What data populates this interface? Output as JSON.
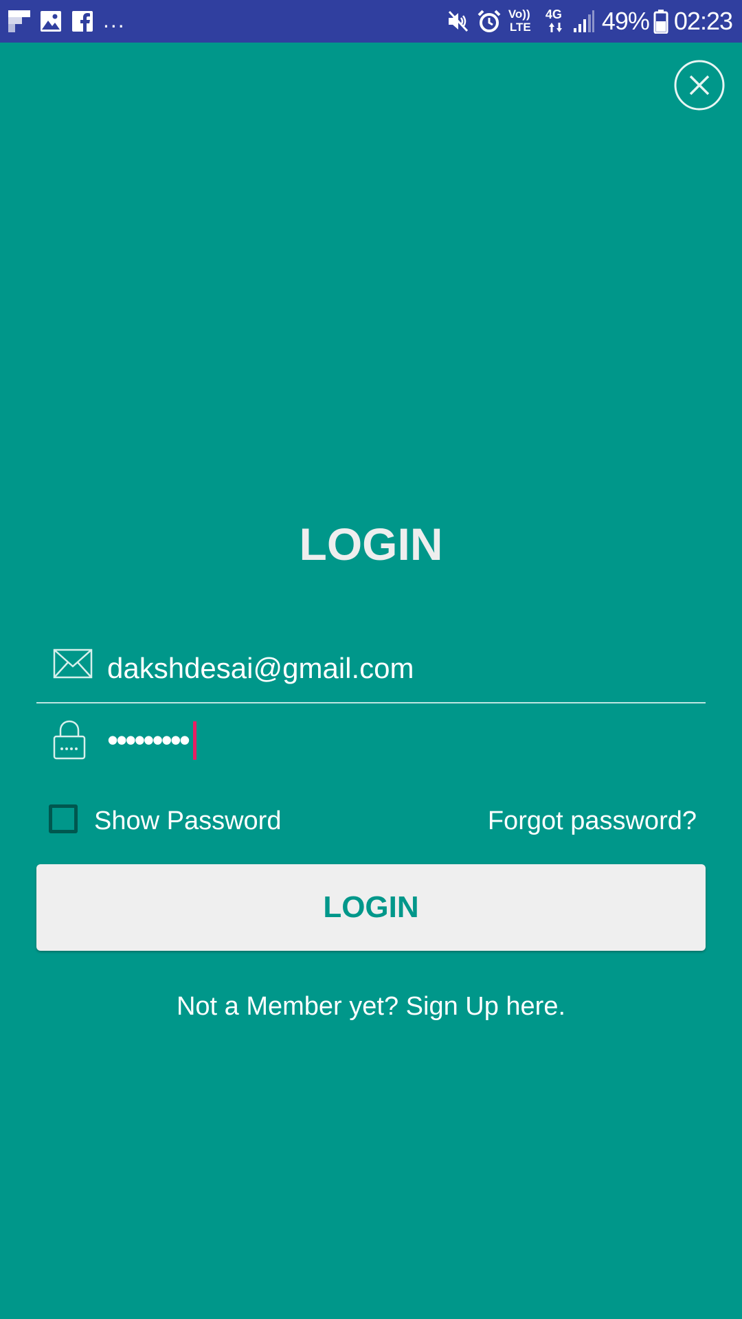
{
  "status_bar": {
    "battery": "49%",
    "time": "02:23",
    "overflow": "...",
    "network_top": "Vo))",
    "network_bottom": "LTE",
    "data_type": "4G",
    "background_color": "#303f9f",
    "icons_left": [
      "flipboard-icon",
      "image-icon",
      "facebook-icon"
    ],
    "icons_right": [
      "mute-icon",
      "alarm-icon",
      "volte-icon",
      "4g-icon",
      "signal-icon",
      "battery-icon"
    ]
  },
  "login": {
    "title": "LOGIN",
    "email_value": "dakshdesai@gmail.com",
    "password_value": "•••••••••",
    "show_password_label": "Show Password",
    "show_password_checked": false,
    "forgot_password_label": "Forgot password?",
    "submit_label": "LOGIN",
    "signup_text": "Not a Member yet? Sign Up here."
  },
  "colors": {
    "background": "#00978a",
    "button_background": "#efefef",
    "button_text": "#00978a",
    "cursor": "#e91e63",
    "checkbox_border": "#00574f"
  }
}
